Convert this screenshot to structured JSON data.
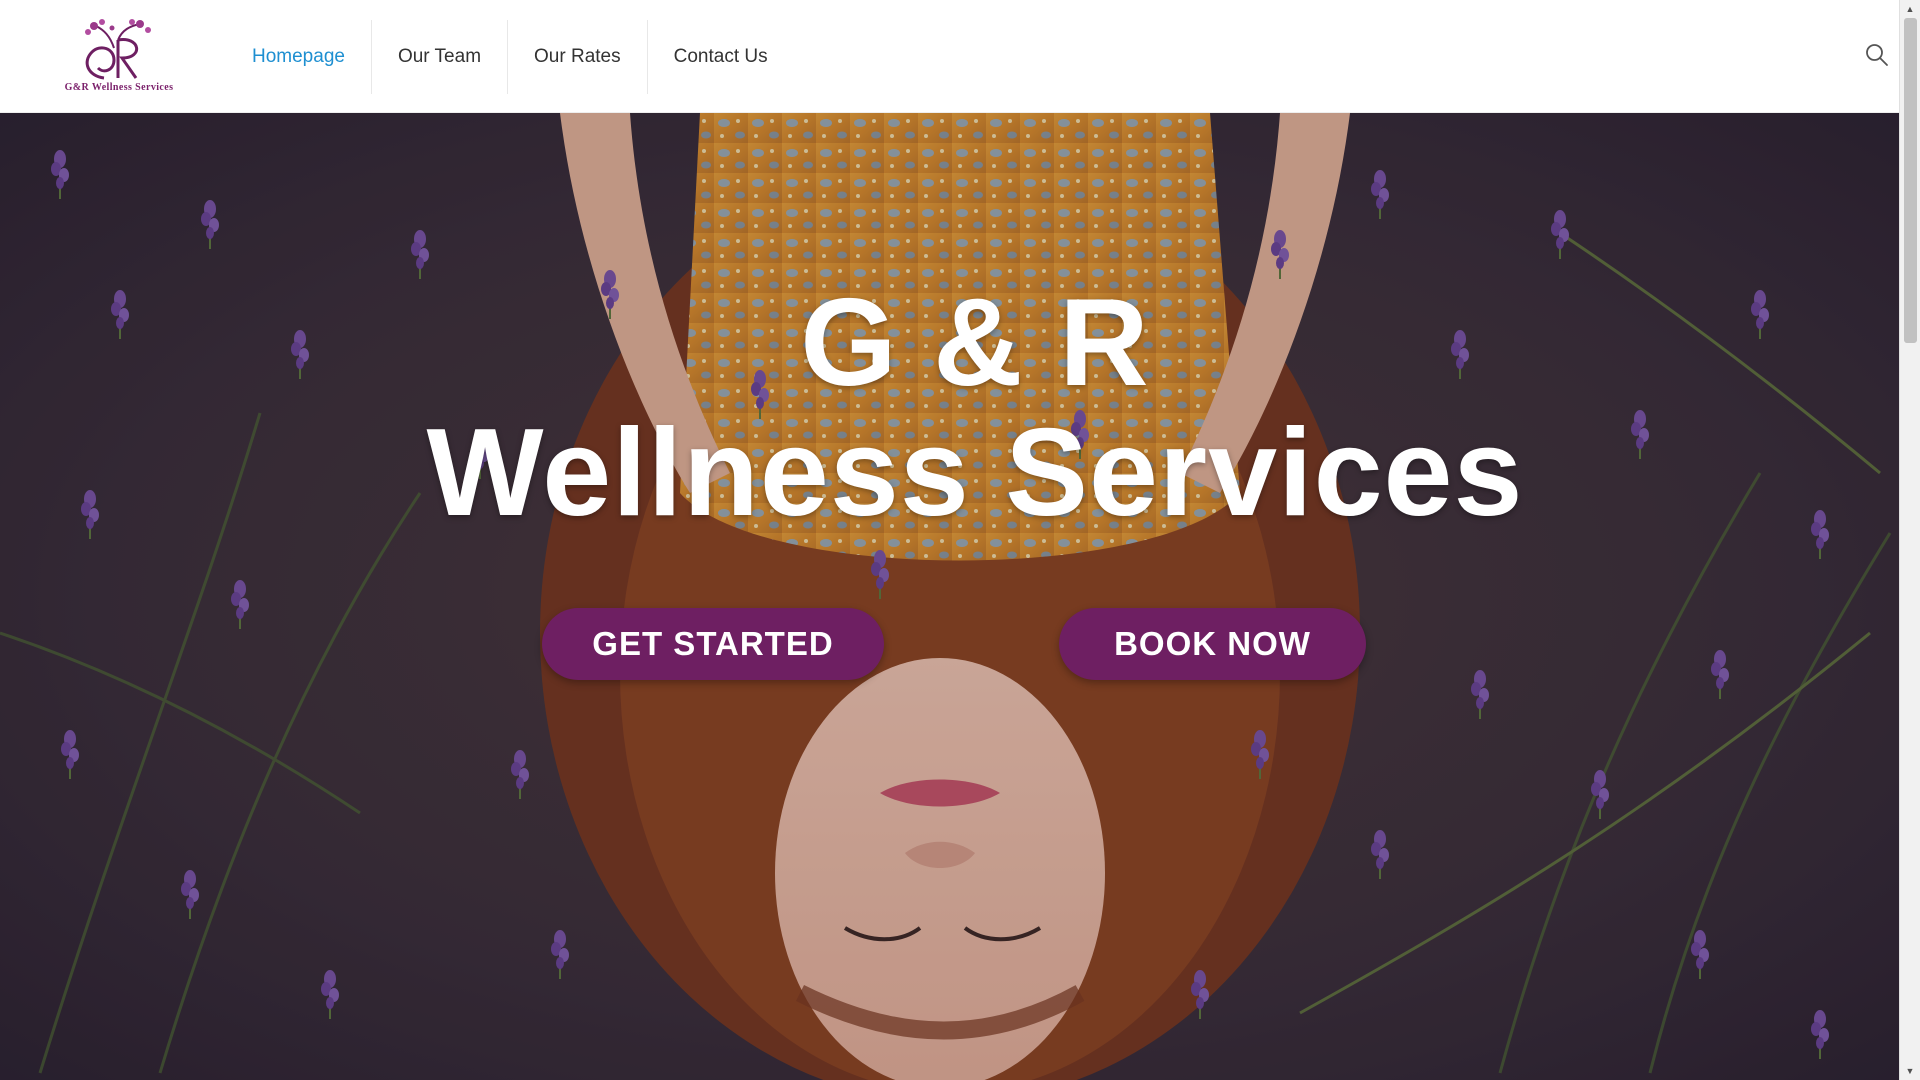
{
  "brand": {
    "logo_text": "G&R Wellness Services",
    "accent_color": "#6e1f62",
    "nav_active_color": "#1e8fd1"
  },
  "nav": {
    "items": [
      {
        "label": "Homepage",
        "active": true
      },
      {
        "label": "Our Team",
        "active": false
      },
      {
        "label": "Our Rates",
        "active": false
      },
      {
        "label": "Contact Us",
        "active": false
      }
    ],
    "search_icon": "search-icon"
  },
  "hero": {
    "title_line1": "G & R",
    "title_line2": "Wellness Services",
    "buttons": {
      "get_started": "GET STARTED",
      "book_now": "BOOK NOW"
    }
  }
}
